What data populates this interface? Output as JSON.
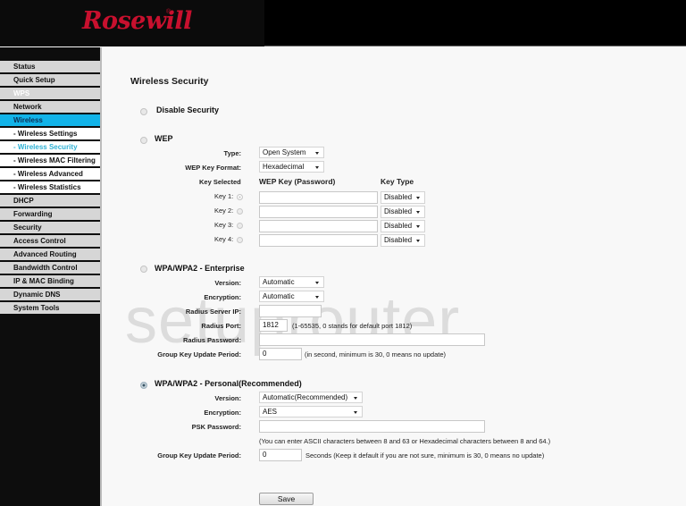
{
  "brand": {
    "logo_text": "Rosewill",
    "logo_mark": "®",
    "logo_color": "#c8102e"
  },
  "watermark": "setuprouter",
  "sidebar": {
    "items": [
      {
        "label": "Status",
        "state": "normal"
      },
      {
        "label": "Quick Setup",
        "state": "normal"
      },
      {
        "label": "WPS",
        "state": "disabled"
      },
      {
        "label": "Network",
        "state": "normal"
      },
      {
        "label": "Wireless",
        "state": "active"
      },
      {
        "label": "- Wireless Settings",
        "state": "sub"
      },
      {
        "label": "- Wireless Security",
        "state": "sub-active"
      },
      {
        "label": "- Wireless MAC Filtering",
        "state": "sub"
      },
      {
        "label": "- Wireless Advanced",
        "state": "sub"
      },
      {
        "label": "- Wireless Statistics",
        "state": "sub"
      },
      {
        "label": "DHCP",
        "state": "normal"
      },
      {
        "label": "Forwarding",
        "state": "normal"
      },
      {
        "label": "Security",
        "state": "normal"
      },
      {
        "label": "Access Control",
        "state": "normal"
      },
      {
        "label": "Advanced Routing",
        "state": "normal"
      },
      {
        "label": "Bandwidth Control",
        "state": "normal"
      },
      {
        "label": "IP & MAC Binding",
        "state": "normal"
      },
      {
        "label": "Dynamic DNS",
        "state": "normal"
      },
      {
        "label": "System Tools",
        "state": "normal"
      }
    ],
    "active_color": "#12b3e8"
  },
  "page": {
    "title": "Wireless Security",
    "disable": {
      "label": "Disable Security",
      "selected": false
    },
    "wep": {
      "label": "WEP",
      "selected": false,
      "type_label": "Type:",
      "type_value": "Open System",
      "format_label": "WEP Key Format:",
      "format_value": "Hexadecimal",
      "col_key_selected": "Key Selected",
      "col_wep_key": "WEP Key (Password)",
      "col_key_type": "Key Type",
      "keys": [
        {
          "label": "Key 1:",
          "selected": true,
          "value": "",
          "type": "Disabled"
        },
        {
          "label": "Key 2:",
          "selected": false,
          "value": "",
          "type": "Disabled"
        },
        {
          "label": "Key 3:",
          "selected": false,
          "value": "",
          "type": "Disabled"
        },
        {
          "label": "Key 4:",
          "selected": false,
          "value": "",
          "type": "Disabled"
        }
      ]
    },
    "enterprise": {
      "label": "WPA/WPA2 - Enterprise",
      "selected": false,
      "version_label": "Version:",
      "version_value": "Automatic",
      "encryption_label": "Encryption:",
      "encryption_value": "Automatic",
      "radius_ip_label": "Radius Server IP:",
      "radius_ip_value": "",
      "radius_port_label": "Radius Port:",
      "radius_port_value": "1812",
      "radius_port_note": "(1-65535, 0 stands for default port 1812)",
      "radius_password_label": "Radius Password:",
      "radius_password_value": "",
      "group_key_label": "Group Key Update Period:",
      "group_key_value": "0",
      "group_key_note": "(in second, minimum is 30, 0 means no update)"
    },
    "personal": {
      "label": "WPA/WPA2 - Personal(Recommended)",
      "selected": true,
      "version_label": "Version:",
      "version_value": "Automatic(Recommended)",
      "encryption_label": "Encryption:",
      "encryption_value": "AES",
      "psk_label": "PSK Password:",
      "psk_value": "",
      "psk_note": "(You can enter ASCII characters between 8 and 63 or Hexadecimal characters between 8 and 64.)",
      "group_key_label": "Group Key Update Period:",
      "group_key_value": "0",
      "group_key_note": "Seconds (Keep it default if you are not sure, minimum is 30, 0 means no update)"
    },
    "save_label": "Save"
  }
}
